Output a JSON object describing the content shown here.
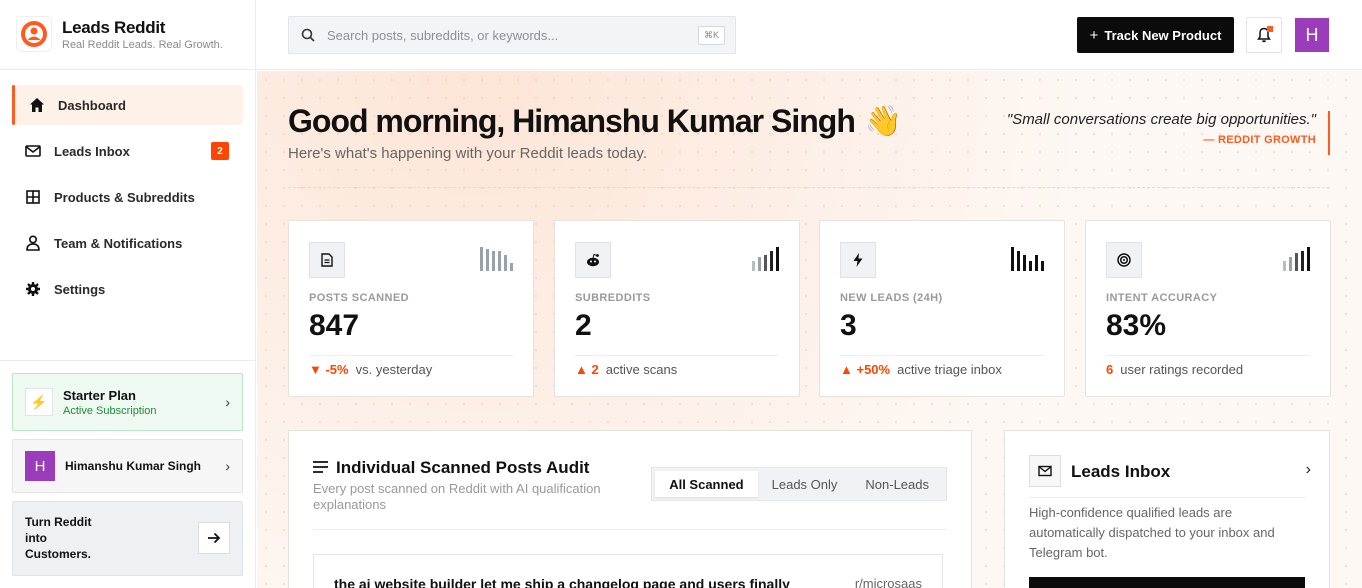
{
  "brand": {
    "name": "Leads Reddit",
    "tagline": "Real Reddit Leads. Real Growth."
  },
  "nav": {
    "items": [
      {
        "label": "Dashboard",
        "icon": "home-icon",
        "active": true
      },
      {
        "label": "Leads Inbox",
        "icon": "mail-icon",
        "badge": "2"
      },
      {
        "label": "Products & Subreddits",
        "icon": "grid-icon"
      },
      {
        "label": "Team & Notifications",
        "icon": "user-icon"
      },
      {
        "label": "Settings",
        "icon": "gear-icon"
      }
    ]
  },
  "plan": {
    "title": "Starter Plan",
    "status": "Active Subscription"
  },
  "user": {
    "name": "Himanshu Kumar Singh",
    "initial": "H"
  },
  "cta": {
    "text": "Turn Reddit into Customers."
  },
  "topbar": {
    "search_placeholder": "Search posts, subreddits, or keywords...",
    "search_shortcut": "⌘K",
    "track_button": "Track New Product"
  },
  "hero": {
    "greeting": "Good morning, Himanshu Kumar Singh",
    "emoji": "👋",
    "subtitle": "Here's what's happening with your Reddit leads today.",
    "quote": "\"Small conversations create big opportunities.\"",
    "quote_source": "— REDDIT GROWTH"
  },
  "stats": [
    {
      "label": "POSTS SCANNED",
      "value": "847",
      "delta": "▼ -5%",
      "note": "vs. yesterday",
      "icon": "document-icon"
    },
    {
      "label": "SUBREDDITS",
      "value": "2",
      "delta": "▲ 2",
      "note": "active scans",
      "icon": "reddit-icon"
    },
    {
      "label": "NEW LEADS (24H)",
      "value": "3",
      "delta": "▲ +50%",
      "note": "active triage inbox",
      "icon": "lightning-icon"
    },
    {
      "label": "INTENT ACCURACY",
      "value": "83%",
      "delta": "6",
      "note": "user ratings recorded",
      "icon": "target-icon"
    }
  ],
  "audit": {
    "title": "Individual Scanned Posts Audit",
    "subtitle": "Every post scanned on Reddit with AI qualification explanations",
    "tabs": [
      "All Scanned",
      "Leads Only",
      "Non-Leads"
    ],
    "active_tab": "All Scanned",
    "rows": [
      {
        "title": "the ai website builder let me ship a changelog page and users finally",
        "subreddit": "r/microsaas"
      }
    ]
  },
  "inbox_card": {
    "title": "Leads Inbox",
    "description": "High-confidence qualified leads are automatically dispatched to your inbox and Telegram bot."
  },
  "colors": {
    "accent": "#ff5a1f",
    "reddit_orange": "#ff4500",
    "avatar_purple": "#9b3dbb",
    "success_green": "#1f8a3a"
  }
}
